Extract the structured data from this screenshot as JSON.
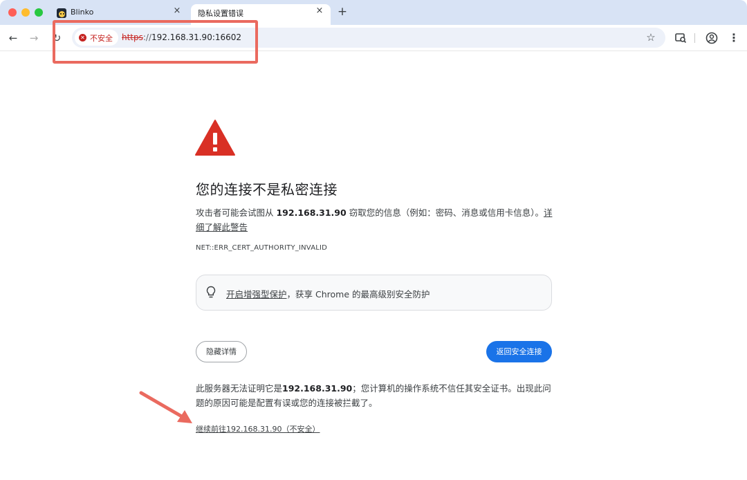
{
  "tabs": [
    {
      "title": "Blinko",
      "close": "×"
    },
    {
      "title": "隐私设置错误",
      "close": "×"
    }
  ],
  "new_tab": "+",
  "toolbar": {
    "back": "←",
    "forward": "→",
    "reload": "↻",
    "security_label": "不安全",
    "url_scheme": "https",
    "url_sep": "://",
    "url_host": "192.168.31.90:16602",
    "menu": "⋮"
  },
  "interstitial": {
    "heading": "您的连接不是私密连接",
    "intro_prefix": "攻击者可能会试图从 ",
    "intro_host": "192.168.31.90",
    "intro_suffix": " 窃取您的信息（例如：密码、消息或信用卡信息）。",
    "learn_more": "详细了解此警告",
    "error_code": "NET::ERR_CERT_AUTHORITY_INVALID",
    "enhanced_link": "开启增强型保护",
    "enhanced_suffix": "，获享 Chrome 的最高级别安全防护",
    "hide_details": "隐藏详情",
    "back_to_safety": "返回安全连接",
    "details_prefix": "此服务器无法证明它是",
    "details_host": "192.168.31.90",
    "details_suffix": "；您计算机的操作系统不信任其安全证书。出现此问题的原因可能是配置有误或您的连接被拦截了。",
    "proceed": "继续前往192.168.31.90（不安全）"
  },
  "colors": {
    "danger": "#c5221f",
    "warning_triangle": "#d93025",
    "primary_button": "#1a73e8",
    "annotation": "#ea6a5f"
  }
}
